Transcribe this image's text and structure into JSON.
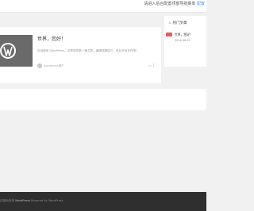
{
  "topbar": {
    "notice_text": "请进入后台配置顶部导航菜单",
    "notice_link": "配置"
  },
  "post": {
    "title": "世界，您好！",
    "excerpt": "欢迎使用 WordPress。这是您的第一篇文章。编辑或删除它，然后开始写作吧！",
    "author": "wordpress用户",
    "comments": "1"
  },
  "sidebar": {
    "widget_title": "热门文章",
    "hot_posts": [
      {
        "title": "世界，您好！",
        "date": "2024-08-20"
      }
    ]
  },
  "footer": {
    "prefix": "自豪地采用",
    "wordpress": "WordPress",
    "powered": "Powered by WordPress"
  },
  "colors": {
    "accent": "#4a90e2",
    "footer_bg": "#2f2f2f",
    "hot_thumb": "#e85a5a"
  }
}
